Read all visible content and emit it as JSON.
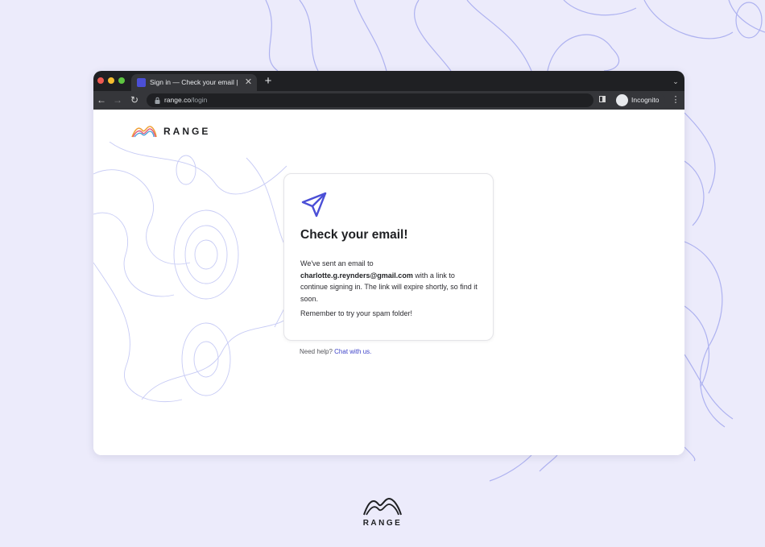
{
  "browser": {
    "tab": {
      "title": "Sign in — Check your email | R",
      "close_glyph": "✕",
      "favicon": "range-favicon-icon"
    },
    "new_tab_glyph": "+",
    "tab_list_glyph": "⌄",
    "nav": {
      "back_glyph": "←",
      "forward_glyph": "→",
      "reload_glyph": "↻"
    },
    "address": {
      "host": "range.co",
      "path": "/login"
    },
    "bookmark_glyph": "☆",
    "profile_label": "Incognito",
    "menu_glyph": "⋮"
  },
  "page": {
    "brand": "RANGE",
    "card": {
      "title": "Check your email!",
      "body_prefix": "We've sent an email to",
      "email": "charlotte.g.reynders@gmail.com",
      "body_suffix": "with a link to continue signing in. The link will expire shortly, so find it soon.",
      "note": "Remember to try your spam folder!"
    },
    "help_prefix": "Need help?",
    "help_link": "Chat with us."
  },
  "footer": {
    "brand": "RANGE"
  },
  "colors": {
    "background": "#ecebfb",
    "accent": "#4b4fd6",
    "link": "#3f44c9",
    "chrome_dark": "#1f2023",
    "chrome_toolbar": "#35363a"
  }
}
